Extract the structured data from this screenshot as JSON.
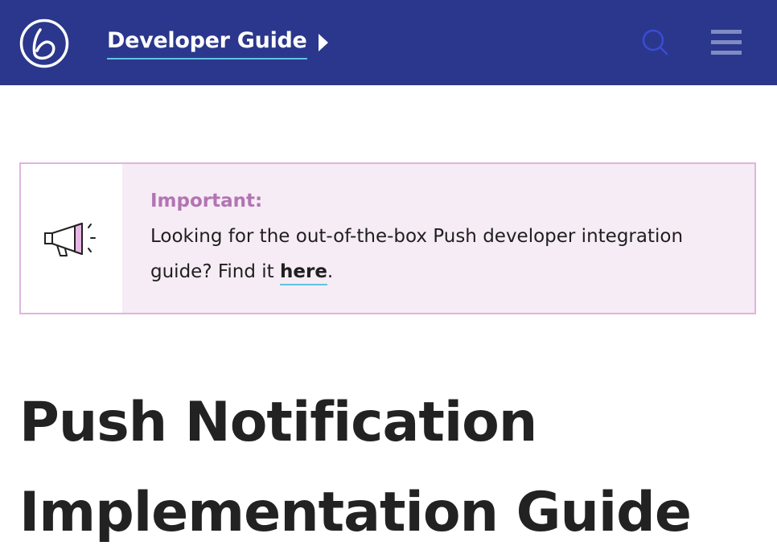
{
  "header": {
    "nav_label": "Developer Guide",
    "logo_icon": "braze-b-logo-icon",
    "search_icon": "search-icon",
    "menu_icon": "hamburger-menu-icon",
    "colors": {
      "background": "#2b378c",
      "underline": "#5fc3e4",
      "search": "#3a4dd0",
      "menu": "#7f8bc2"
    }
  },
  "callout": {
    "icon": "megaphone-icon",
    "title": "Important:",
    "text_before": "Looking for the out-of-the-box Push developer integration guide? Find it ",
    "link_label": "here",
    "text_after": ".",
    "colors": {
      "title": "#b274b3",
      "border": "#e0b4df",
      "background": "#f6ecf5"
    }
  },
  "page": {
    "title": "Push Notification Implementation Guide"
  }
}
